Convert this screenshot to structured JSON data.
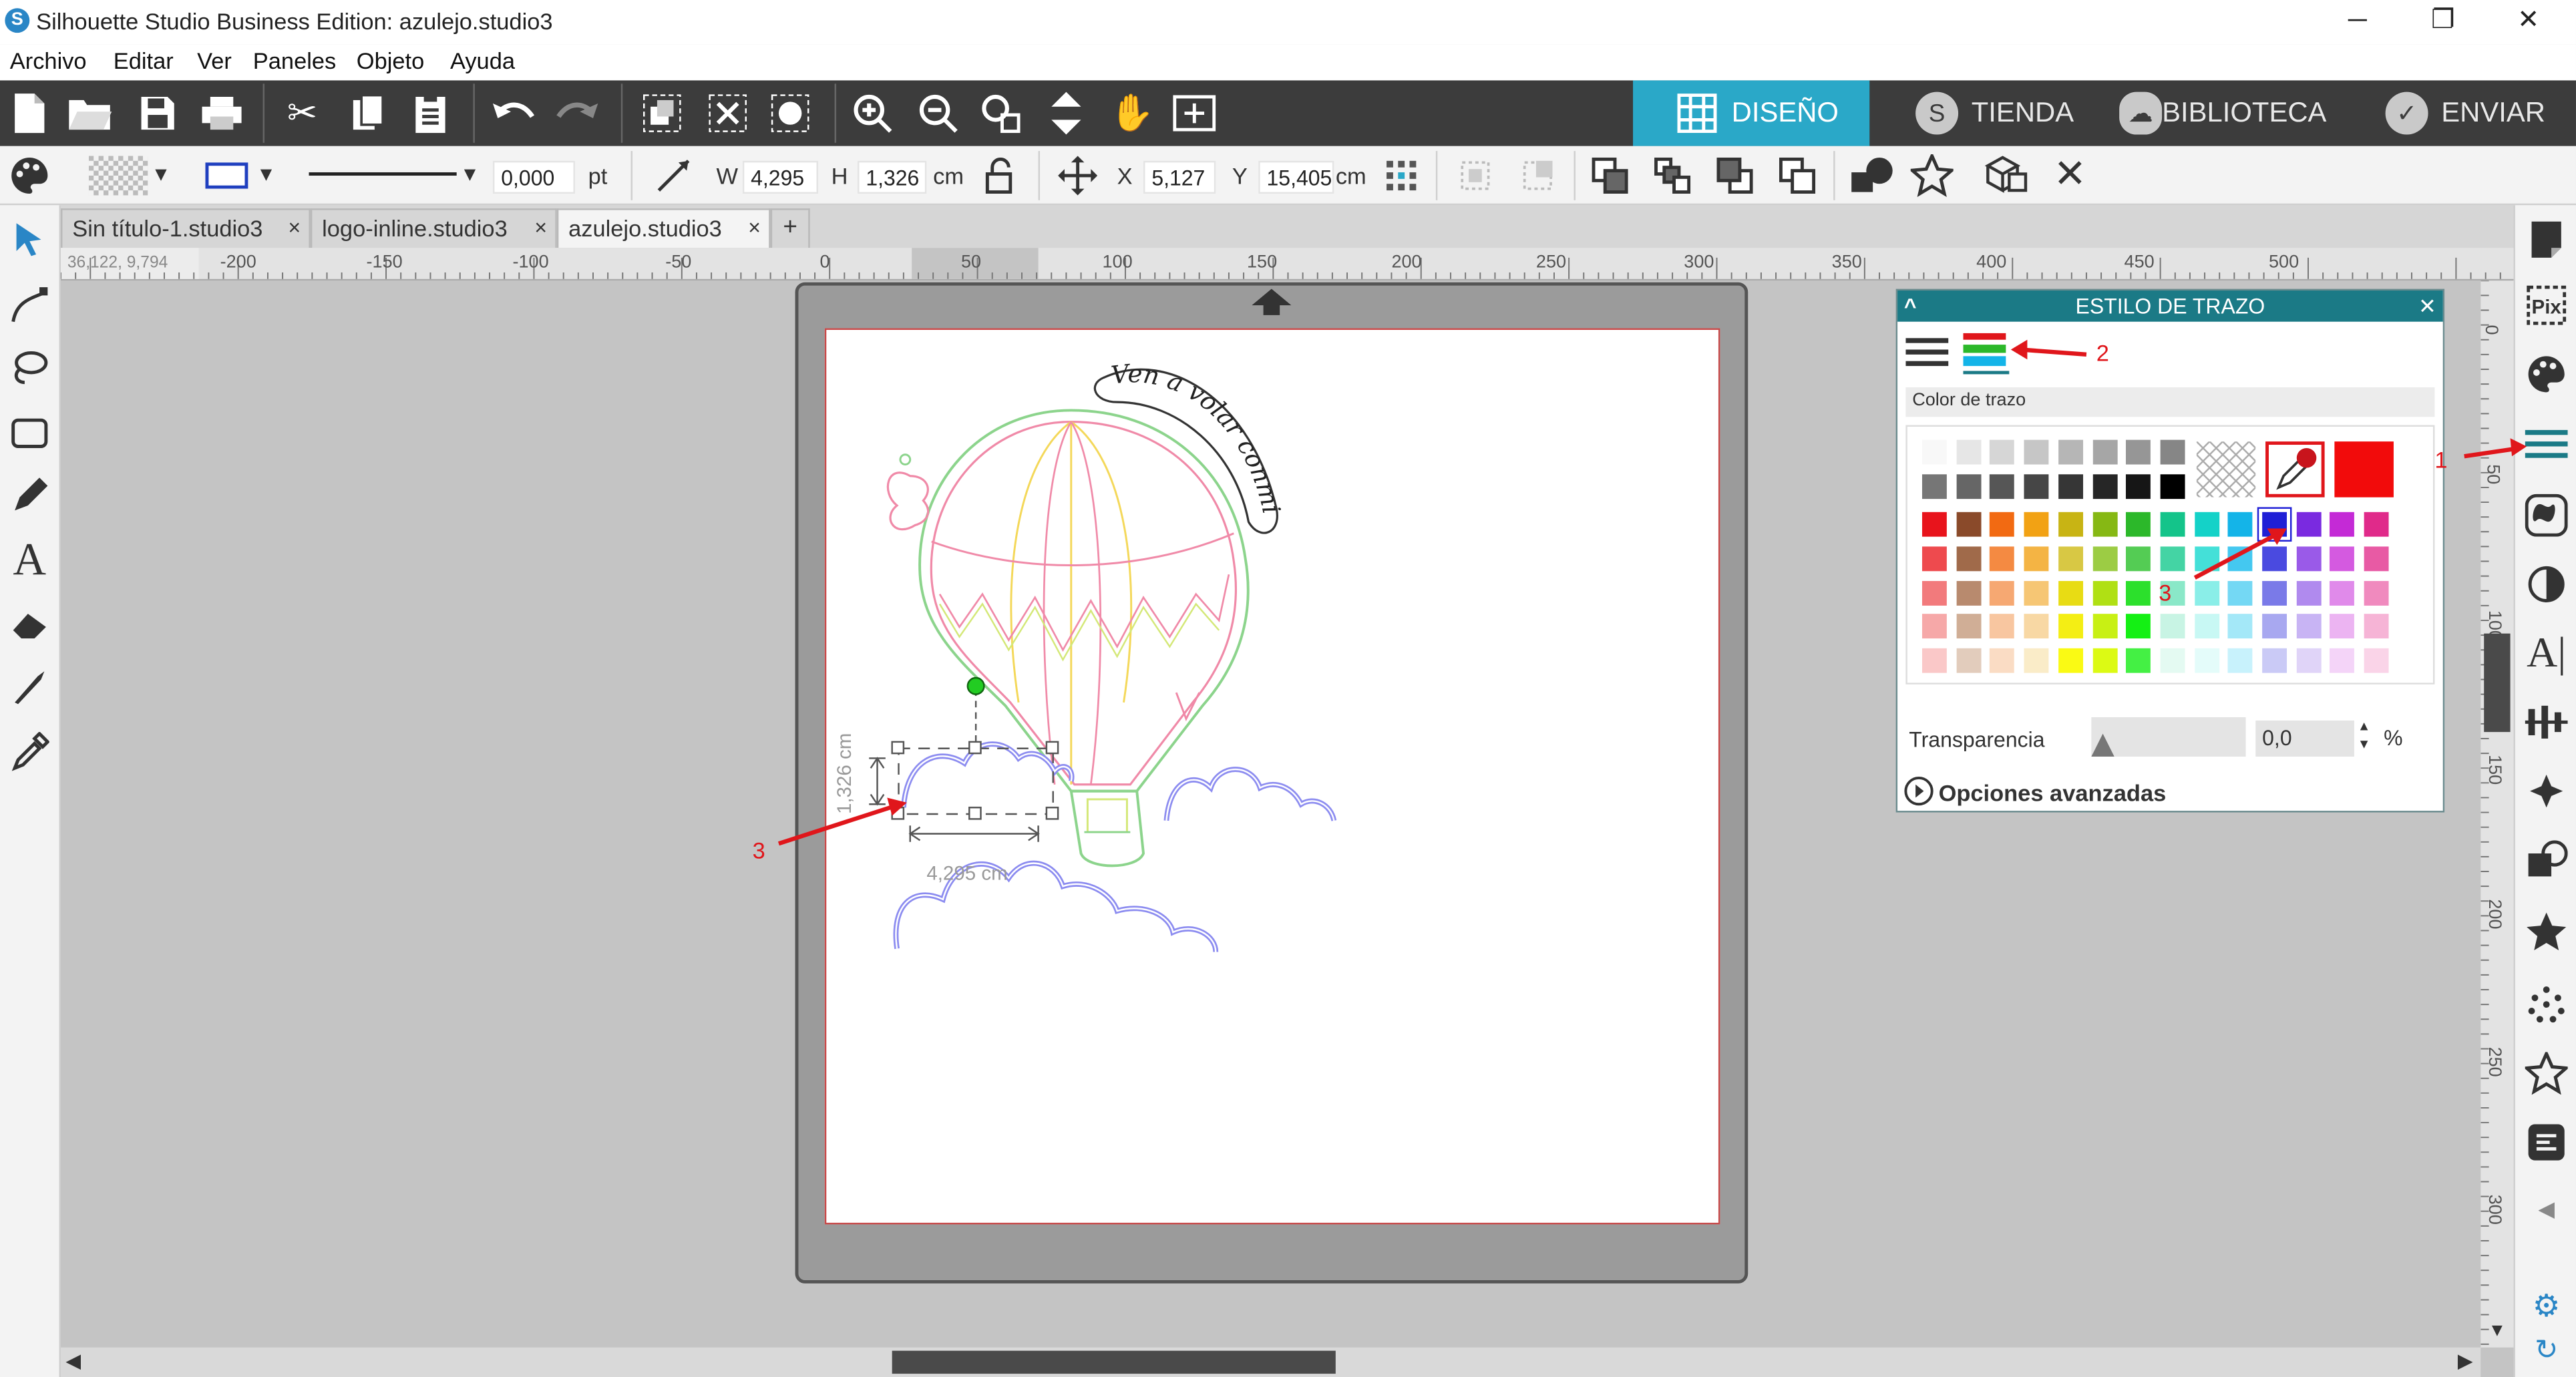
{
  "app": {
    "title": "Silhouette Studio Business Edition: azulejo.studio3",
    "logo_letter": "S",
    "window_controls": [
      "─",
      "❐",
      "✕"
    ]
  },
  "menu": [
    "Archivo",
    "Editar",
    "Ver",
    "Paneles",
    "Objeto",
    "Ayuda"
  ],
  "nav_tabs": [
    {
      "label": "DISEÑO",
      "icon": "grid-icon",
      "active": true
    },
    {
      "label": "TIENDA",
      "icon": "silhouette-s-icon",
      "active": false
    },
    {
      "label": "BIBLIOTECA",
      "icon": "cloud-icon",
      "active": false
    },
    {
      "label": "ENVIAR",
      "icon": "check-icon",
      "active": false
    }
  ],
  "properties_bar": {
    "line_width": "0,000",
    "line_unit": "pt",
    "w_label": "W",
    "w_value": "4,295",
    "h_label": "H",
    "h_value": "1,326",
    "size_unit": "cm",
    "x_label": "X",
    "x_value": "5,127",
    "y_label": "Y",
    "y_value": "15,405",
    "pos_unit": "cm"
  },
  "doc_tabs": [
    {
      "label": "Sin título-1.studio3",
      "close": "×",
      "active": false
    },
    {
      "label": "logo-inline.studio3",
      "close": "×",
      "active": false
    },
    {
      "label": "azulejo.studio3",
      "close": "×",
      "active": true
    }
  ],
  "new_tab_label": "+",
  "ruler": {
    "coords": "36,122, 9,794",
    "h_ticks": [
      "-200",
      "-150",
      "-100",
      "-50",
      "0",
      "50",
      "100",
      "150",
      "200",
      "250",
      "300",
      "350",
      "400",
      "450",
      "500"
    ],
    "v_ticks": [
      "0",
      "50",
      "100",
      "150",
      "200",
      "250",
      "300"
    ]
  },
  "canvas": {
    "arc_text": "Ven a volar conmigo",
    "dim_height": "1,326 cm",
    "dim_width": "4,295 cm"
  },
  "panel": {
    "title": "ESTILO DE TRAZO",
    "collapse": "^",
    "close": "✕",
    "section_label": "Color de trazo",
    "transparency_label": "Transparencia",
    "transparency_value": "0,0",
    "transparency_unit": "%",
    "advanced_label": "Opciones avanzadas",
    "current_color": "#f20b0b",
    "selected_color": "#1f1fd6",
    "palette_rows": [
      [
        "#f8f8f8",
        "#e6e6e6",
        "#d6d6d6",
        "#c6c6c6",
        "#b6b6b6",
        "#a6a6a6",
        "#969696",
        "#868686"
      ],
      [
        "#767676",
        "#666666",
        "#565656",
        "#464646",
        "#363636",
        "#262626",
        "#161616",
        "#000000"
      ],
      [
        "#e8141c",
        "#8a4a2a",
        "#f26a12",
        "#f2a214",
        "#c8b414",
        "#86b814",
        "#2cb82a",
        "#14c48a",
        "#14d2c8",
        "#14b4e8",
        "#1f1fd6",
        "#7a2ae0",
        "#c42ad6",
        "#e02a8a"
      ],
      [
        "#ee4a4e",
        "#a06a4a",
        "#f48a42",
        "#f4b444",
        "#d8c844",
        "#9ccc44",
        "#54cc54",
        "#44d4a4",
        "#44e0d8",
        "#44c8f0",
        "#4a4ae0",
        "#9a5ae8",
        "#d45ae0",
        "#e85aa4"
      ],
      [
        "#f27a7c",
        "#b88a6e",
        "#f6a872",
        "#f6c674",
        "#e8dc14",
        "#b0e014",
        "#2ce02c",
        "#8ae8c8",
        "#8aeee8",
        "#74d8f4",
        "#7a7ae8",
        "#b08aee",
        "#e08aea",
        "#f08abe"
      ],
      [
        "#f6a8a8",
        "#d0ae96",
        "#f8c6a0",
        "#f8d8a4",
        "#f4ee14",
        "#c8f014",
        "#14f014",
        "#c8f4e4",
        "#c8f8f4",
        "#a4e8f8",
        "#a8a8f0",
        "#c8b4f4",
        "#ecb4f2",
        "#f6b4d6"
      ],
      [
        "#fac8c8",
        "#e2ccbc",
        "#fadcc4",
        "#faecc8",
        "#fafa14",
        "#dcfa14",
        "#44f044",
        "#e4faf2",
        "#e4fcfa",
        "#c8f2fc",
        "#cacaf6",
        "#e0d4f8",
        "#f4d4f8",
        "#fad4e8"
      ]
    ]
  },
  "annotations": [
    "1",
    "2",
    "3",
    "3"
  ]
}
